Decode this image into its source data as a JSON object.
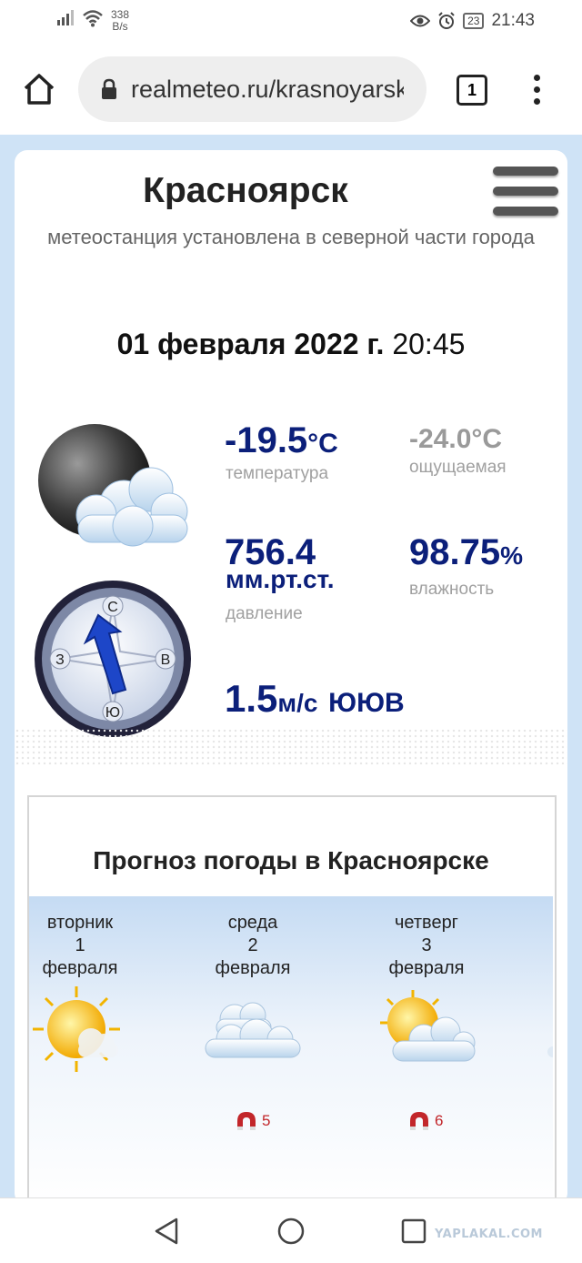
{
  "status_bar": {
    "net_speed_value": "338",
    "net_speed_unit": "B/s",
    "battery": "23",
    "time": "21:43"
  },
  "browser": {
    "url": "realmeteo.ru/krasnoyarsk",
    "tab_count": "1"
  },
  "site": {
    "city": "Красноярск",
    "subtitle": "метеостанция установлена в северной части города",
    "date": "01 февраля 2022 г.",
    "time": "20:45"
  },
  "current": {
    "temperature_value": "-19.5",
    "temperature_unit": "°C",
    "temperature_label": "температура",
    "feels_like": "-24.0°C",
    "feels_like_label": "ощущаемая",
    "pressure_value": "756.4",
    "pressure_unit": "мм.рт.ст.",
    "pressure_label": "давление",
    "humidity_value": "98.75",
    "humidity_unit": "%",
    "humidity_label": "влажность",
    "wind_speed": "1.5",
    "wind_unit": "м/с",
    "wind_dir": "ЮЮВ"
  },
  "compass": {
    "n": "С",
    "s": "Ю",
    "w": "З",
    "e": "В"
  },
  "forecast": {
    "title": "Прогноз погоды в Красноярске",
    "days": [
      {
        "weekday": "вторник",
        "day": "1",
        "month": "февраля",
        "icon": "sun-cloud-icon",
        "magnetic": ""
      },
      {
        "weekday": "среда",
        "day": "2",
        "month": "февраля",
        "icon": "cloudy-icon",
        "magnetic": "5"
      },
      {
        "weekday": "четверг",
        "day": "3",
        "month": "февраля",
        "icon": "sun-cloud-icon",
        "magnetic": "6"
      }
    ]
  },
  "watermark": "YAPLAKAL.COM",
  "colors": {
    "accent_dark_blue": "#0b1f7a",
    "page_bg": "#cfe3f6",
    "magnet_red": "#c2262a"
  }
}
